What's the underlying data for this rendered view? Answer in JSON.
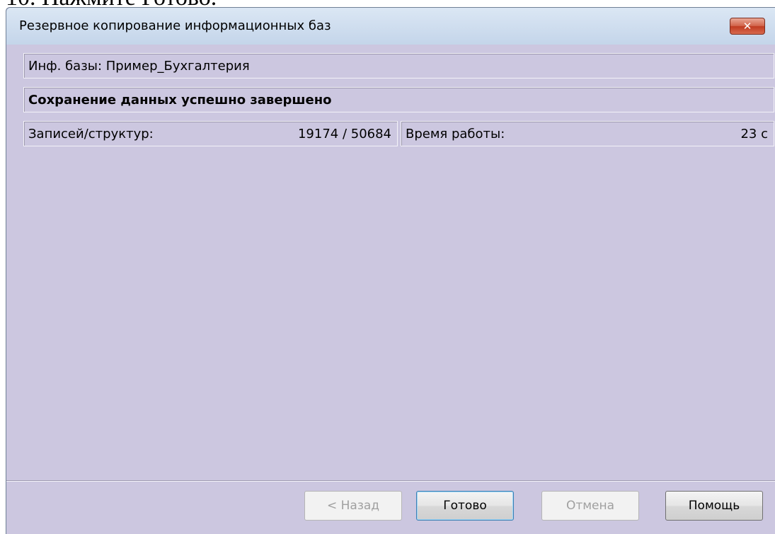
{
  "document": {
    "caption": "10. Нажмите Готово."
  },
  "window": {
    "title": "Резервное копирование информационных баз",
    "close_glyph": "✕"
  },
  "info": {
    "bases_label": "Инф. базы:  Пример_Бухгалтерия",
    "status": "Сохранение данных успешно завершено",
    "records_label": "Записей/структур:",
    "records_value": "19174 / 50684",
    "time_label": "Время работы:",
    "time_value": "23 с"
  },
  "buttons": {
    "back": "< Назад",
    "done": "Готово",
    "cancel": "Отмена",
    "help": "Помощь"
  },
  "colors": {
    "window_bg": "#ccc7e0",
    "titlebar": "#c4d5ea",
    "close_button": "#c03b20"
  }
}
